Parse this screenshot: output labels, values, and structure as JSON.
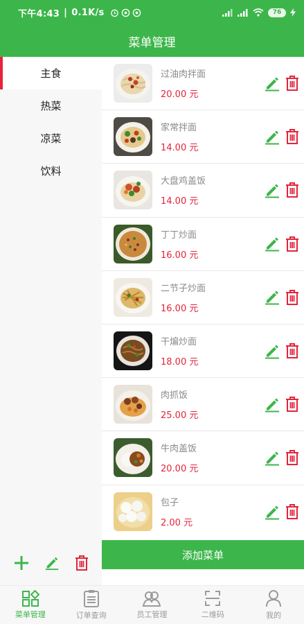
{
  "status": {
    "time": "下午4:43",
    "speed": "0.1K/s",
    "battery": "76"
  },
  "header": {
    "title": "菜单管理"
  },
  "categories": [
    {
      "label": "主食",
      "active": true
    },
    {
      "label": "热菜"
    },
    {
      "label": "凉菜"
    },
    {
      "label": "饮料"
    }
  ],
  "dishes": [
    {
      "name": "过油肉拌面",
      "price": "20.00 元",
      "image": "noodles-sauce"
    },
    {
      "name": "家常拌面",
      "price": "14.00 元",
      "image": "noodles-veg"
    },
    {
      "name": "大盘鸡盖饭",
      "price": "14.00 元",
      "image": "chicken-rice"
    },
    {
      "name": "丁丁炒面",
      "price": "16.00 元",
      "image": "diced-noodles"
    },
    {
      "name": "二节子炒面",
      "price": "16.00 元",
      "image": "stir-fry-noodles"
    },
    {
      "name": "干煸炒面",
      "price": "18.00 元",
      "image": "dry-fried-noodles"
    },
    {
      "name": "肉抓饭",
      "price": "25.00 元",
      "image": "pilaf"
    },
    {
      "name": "牛肉盖饭",
      "price": "20.00 元",
      "image": "beef-rice"
    },
    {
      "name": "包子",
      "price": "2.00 元",
      "image": "steamed-buns"
    }
  ],
  "add_button": "添加菜单",
  "tabs": [
    {
      "label": "菜单管理",
      "icon": "menu-grid-icon",
      "active": true
    },
    {
      "label": "订单查询",
      "icon": "clipboard-icon"
    },
    {
      "label": "员工管理",
      "icon": "people-icon"
    },
    {
      "label": "二维码",
      "icon": "qr-scan-icon"
    },
    {
      "label": "我的",
      "icon": "user-icon"
    }
  ],
  "colors": {
    "primary": "#3cb64a",
    "price": "#e2243b",
    "delete": "#e2243b",
    "edit": "#3cb64a"
  }
}
